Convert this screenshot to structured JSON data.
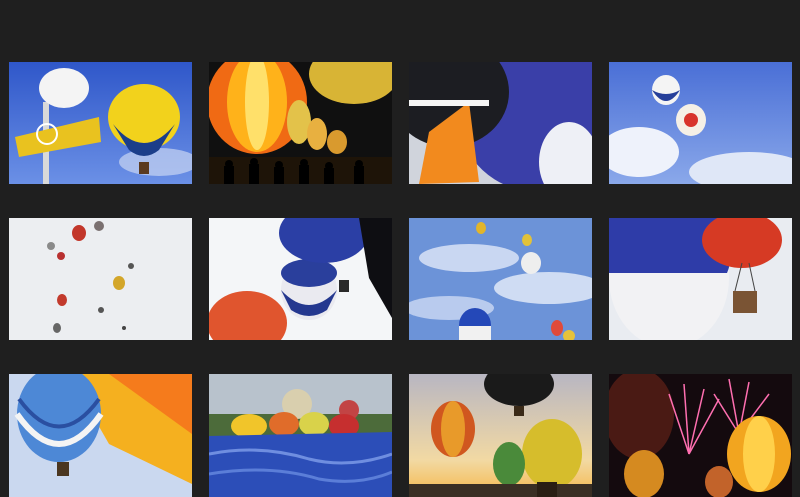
{
  "gallery": {
    "columns": 4,
    "rows": 3,
    "thumbnails": [
      {
        "subject": "balloon-with-sign-pole"
      },
      {
        "subject": "night-glow-balloons-crowd"
      },
      {
        "subject": "large-blue-sponsor-balloon"
      },
      {
        "subject": "two-balloons-blue-sky"
      },
      {
        "subject": "many-balloons-white-sky"
      },
      {
        "subject": "red-and-blue-white-balloons"
      },
      {
        "subject": "balloons-cloudy-blue-sky"
      },
      {
        "subject": "blue-white-balloon-red-balloon-basket"
      },
      {
        "subject": "blue-striped-and-yellow-balloons"
      },
      {
        "subject": "balloons-inflating-on-field"
      },
      {
        "subject": "balloons-sunset-silhouette"
      },
      {
        "subject": "balloons-fireworks-night"
      }
    ]
  }
}
